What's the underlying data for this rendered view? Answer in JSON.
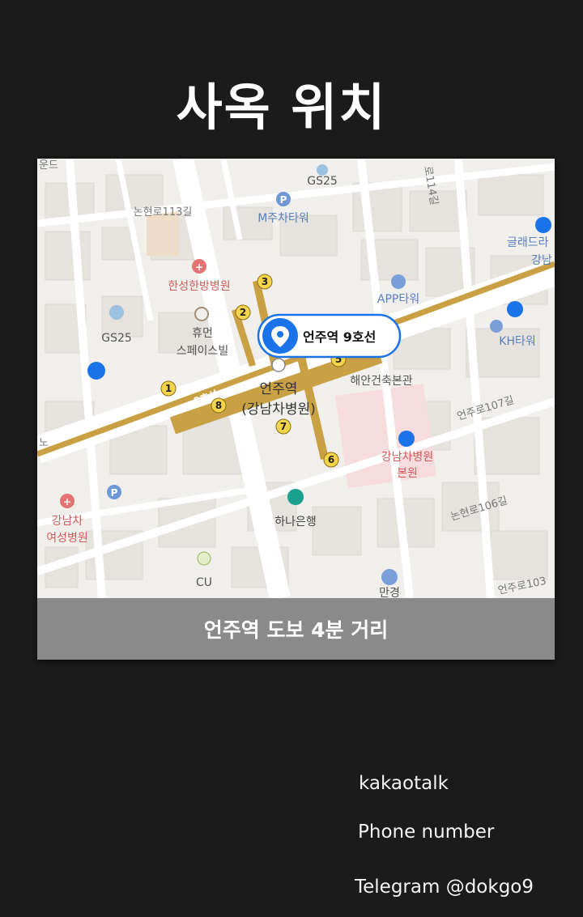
{
  "page": {
    "title": "사옥 위치"
  },
  "map": {
    "caption": "언주역 도보 4분 거리",
    "pin_label": "언주역 9호선",
    "station_name_line1": "언주역",
    "station_name_line2": "(강남차병원)",
    "line_badge": "9호선",
    "exits": [
      "1",
      "2",
      "3",
      "5",
      "6",
      "7",
      "8"
    ],
    "labels": {
      "gs25_top": "GS25",
      "mjucha": "M주차타워",
      "nonhyeon113": "논현로113길",
      "hansung": "한성한방병원",
      "gs25_left": "GS25",
      "human1": "휴먼",
      "human2": "스페이스빌",
      "app_tower": "APP타워",
      "haean": "해안건축본관",
      "kh_tower": "KH타워",
      "glad1": "글래드라",
      "glad2": "강남",
      "eonju107": "언주로107길",
      "cha1": "강남차병원",
      "cha2": "본원",
      "hana": "하나은행",
      "nonhyeon106": "논현로106길",
      "gangnamcha1": "강남차",
      "gangnamcha2": "여성병원",
      "cu": "CU",
      "mangyeong": "만경",
      "eonju103": "언주로103",
      "road_114": "로114길",
      "top_left": "운드",
      "left_edge": "노"
    }
  },
  "contacts": {
    "kakaotalk": "kakaotalk",
    "phone": "Phone number",
    "telegram": "Telegram @dokgo9"
  },
  "colors": {
    "background": "#1b1b1b",
    "subway_line": "#c9a043",
    "pin_blue": "#1a73e8",
    "caption_bar": "#8a8a8a"
  }
}
